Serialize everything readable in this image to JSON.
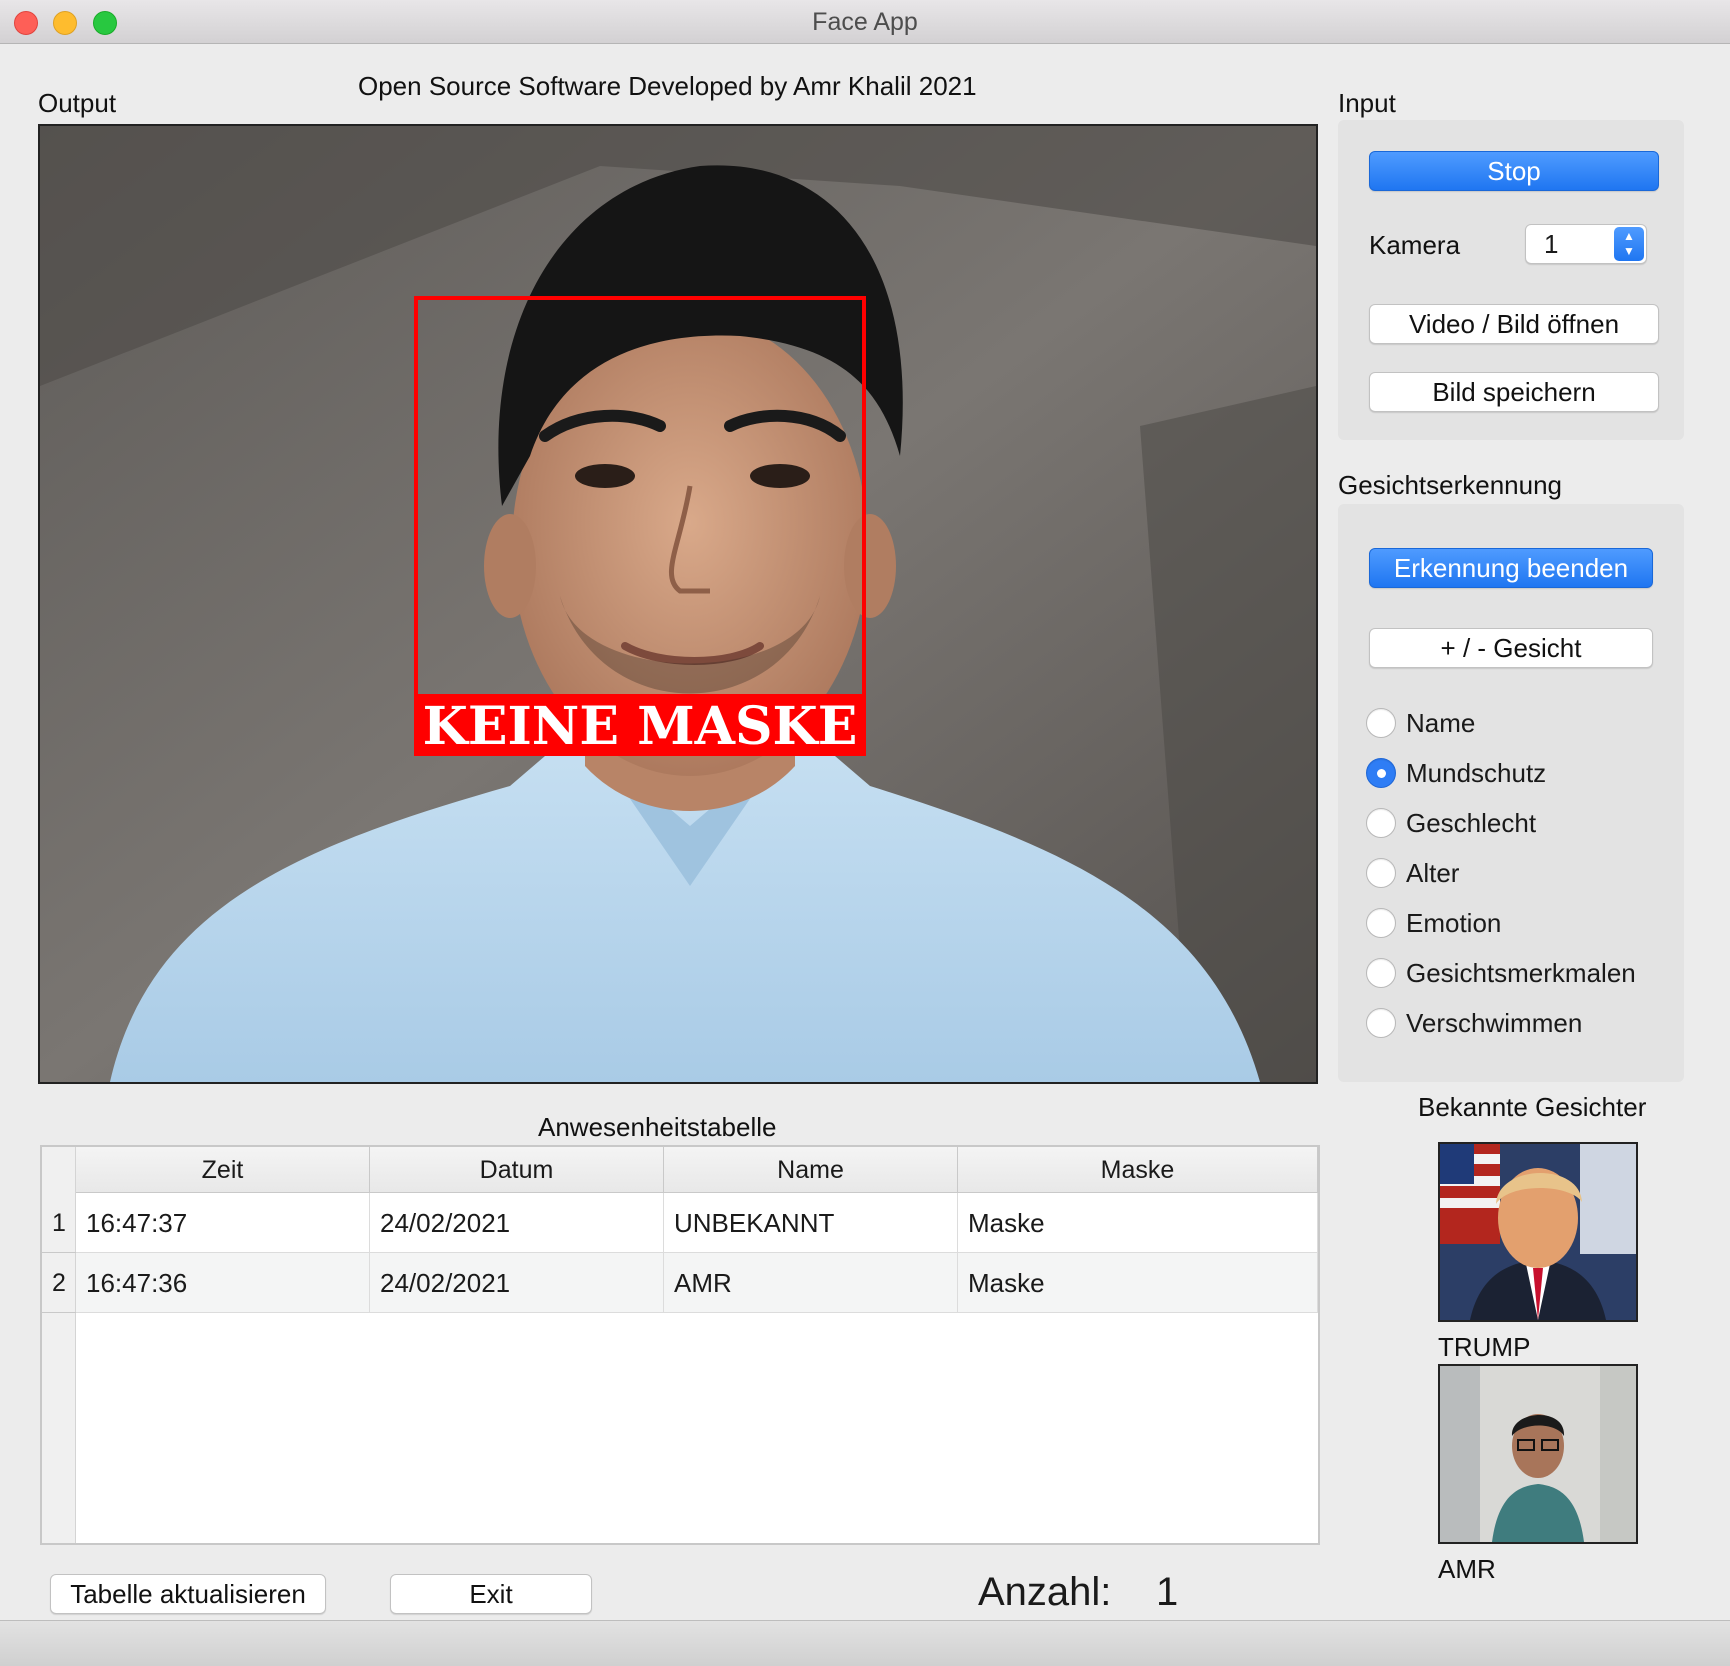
{
  "window": {
    "title": "Face App"
  },
  "credits": "Open Source Software Developed by Amr Khalil 2021",
  "output": {
    "label": "Output",
    "detection_text": "KEINE MASKE"
  },
  "input": {
    "label": "Input",
    "stop_label": "Stop",
    "kamera_label": "Kamera",
    "kamera_value": "1",
    "open_label": "Video / Bild  öffnen",
    "save_label": "Bild speichern"
  },
  "recognition": {
    "label": "Gesichtserkennung",
    "stop_label": "Erkennung beenden",
    "face_label": "+ / - Gesicht",
    "options": [
      "Name",
      "Mundschutz",
      "Geschlecht",
      "Alter",
      "Emotion",
      "Gesichtsmerkmalen",
      "Verschwimmen"
    ],
    "selected": "Mundschutz"
  },
  "known_faces": {
    "label": "Bekannte Gesichter",
    "faces": [
      "TRUMP",
      "AMR"
    ]
  },
  "table": {
    "title": "Anwesenheitstabelle",
    "columns": [
      "Zeit",
      "Datum",
      "Name",
      "Maske"
    ],
    "rows": [
      {
        "num": "1",
        "cells": [
          "16:47:37",
          "24/02/2021",
          "UNBEKANNT",
          "Maske"
        ]
      },
      {
        "num": "2",
        "cells": [
          "16:47:36",
          "24/02/2021",
          "AMR",
          "Maske"
        ]
      }
    ]
  },
  "footer": {
    "refresh_label": "Tabelle aktualisieren",
    "exit_label": "Exit",
    "count_label": "Anzahl:",
    "count_value": "1"
  },
  "colors": {
    "accent": "#2e7df5",
    "detection_box": "#ff0000"
  }
}
